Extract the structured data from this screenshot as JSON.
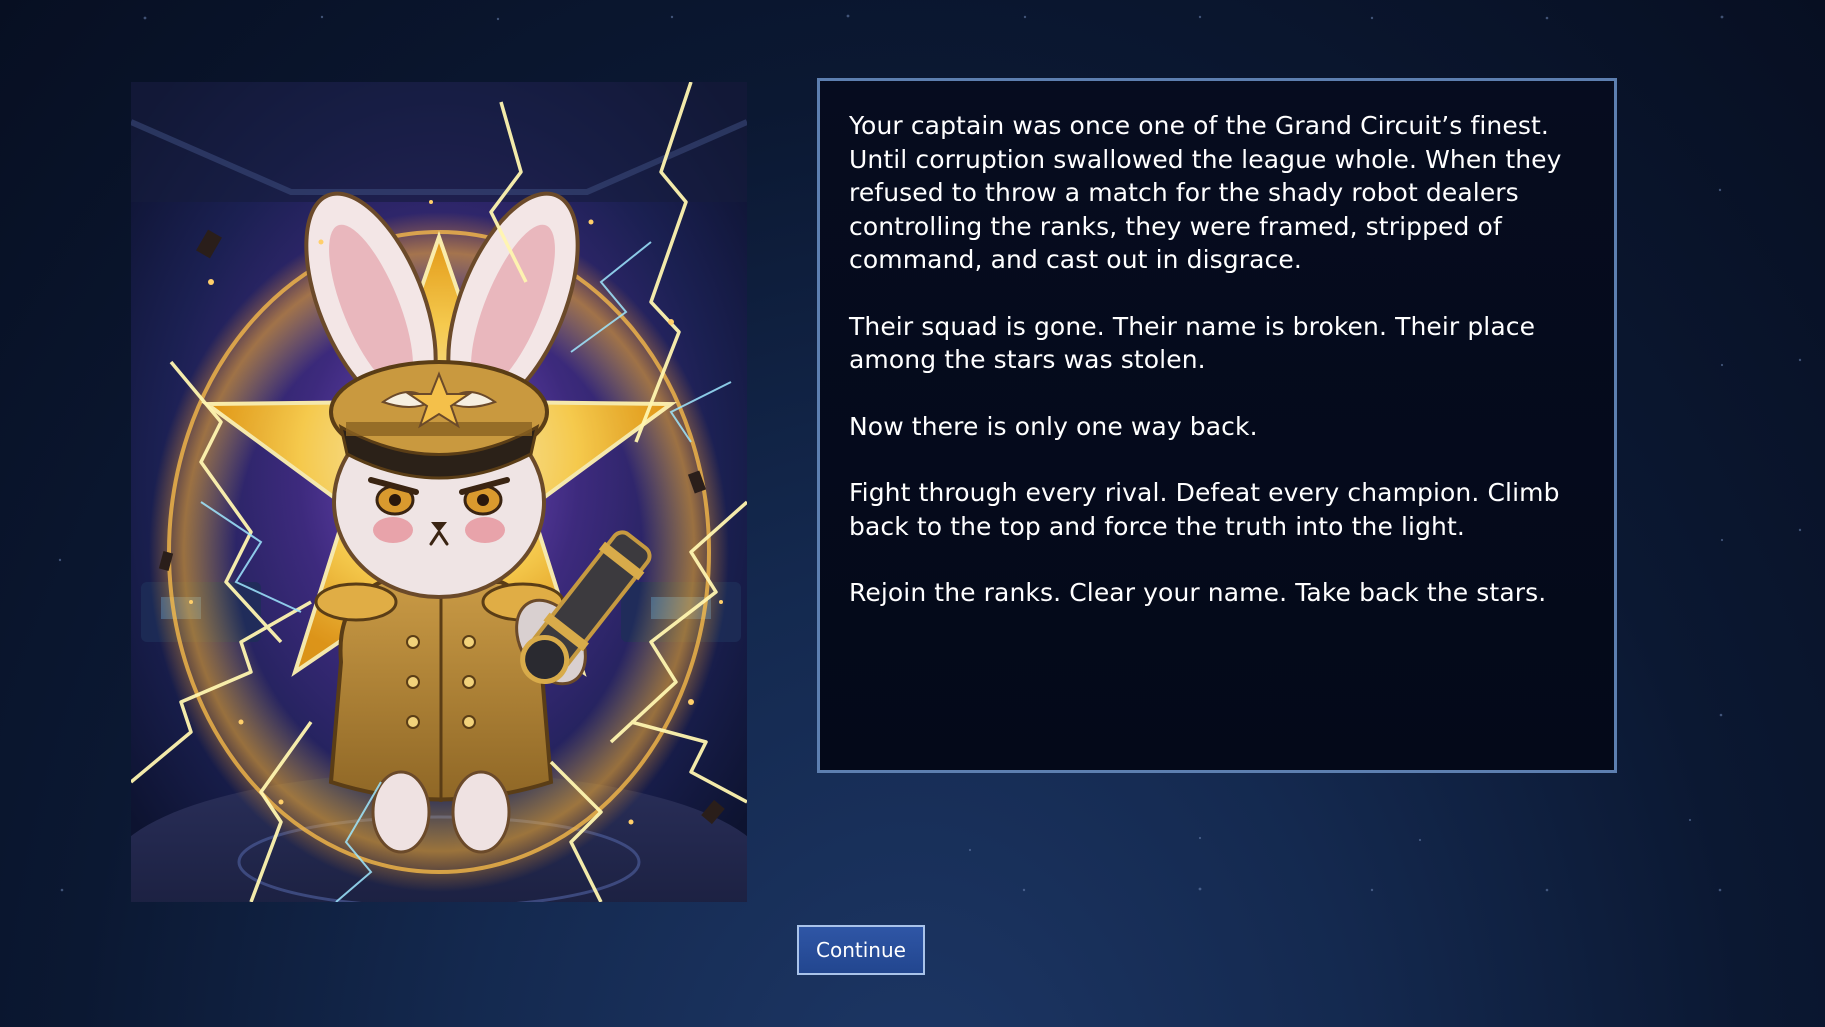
{
  "story": {
    "paragraphs": [
      "Your captain was once one of the Grand Circuit’s finest. Until corruption swallowed the league whole. When they refused to throw a match for the shady robot dealers controlling the ranks, they were framed, stripped of command, and cast out in disgrace.",
      "Their squad is gone. Their name is broken. Their place among the stars was stolen.",
      "Now there is only one way back.",
      "Fight through every rival. Defeat every champion. Climb back to the top and force the truth into the light.",
      "Rejoin the ranks. Clear your name. Take back the stars."
    ]
  },
  "portrait": {
    "subject": "rabbit captain in gold military uniform holding a spyglass, surrounded by lightning and a golden star",
    "icon": "rabbit-captain-portrait"
  },
  "actions": {
    "continue_label": "Continue"
  },
  "colors": {
    "background": "#0c1a36",
    "panel_border": "#5d7fb0",
    "button": "#2a4f9c",
    "button_border": "#a9c3ea",
    "gold": "#e8b53c",
    "lightning": "#fff6b0"
  }
}
